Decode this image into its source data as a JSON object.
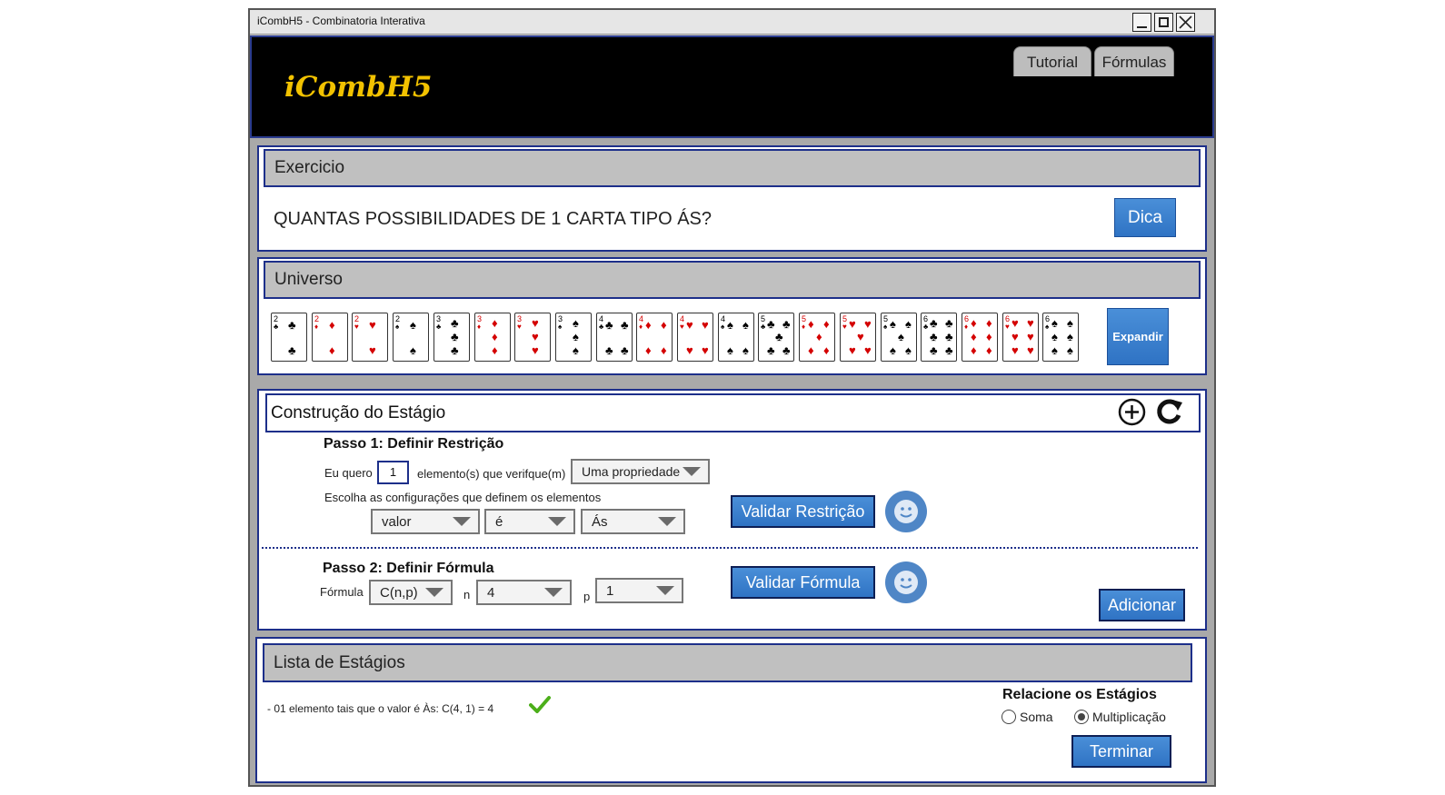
{
  "window": {
    "title": "iCombH5 - Combinatoria Interativa"
  },
  "header": {
    "logo": "iCombH5",
    "tabs": [
      {
        "label": "Tutorial"
      },
      {
        "label": "Fórmulas"
      }
    ]
  },
  "exercise": {
    "title": "Exercicio",
    "question": "QUANTAS POSSIBILIDADES DE 1 CARTA TIPO ÁS?",
    "hint_button": "Dica"
  },
  "universe": {
    "title": "Universo",
    "expand_button": "Expandir",
    "cards": [
      {
        "rank": "2",
        "suit": "♣",
        "color": "#000000"
      },
      {
        "rank": "2",
        "suit": "♦",
        "color": "#d40000"
      },
      {
        "rank": "2",
        "suit": "♥",
        "color": "#d40000"
      },
      {
        "rank": "2",
        "suit": "♠",
        "color": "#000000"
      },
      {
        "rank": "3",
        "suit": "♣",
        "color": "#000000"
      },
      {
        "rank": "3",
        "suit": "♦",
        "color": "#d40000"
      },
      {
        "rank": "3",
        "suit": "♥",
        "color": "#d40000"
      },
      {
        "rank": "3",
        "suit": "♠",
        "color": "#000000"
      },
      {
        "rank": "4",
        "suit": "♣",
        "color": "#000000"
      },
      {
        "rank": "4",
        "suit": "♦",
        "color": "#d40000"
      },
      {
        "rank": "4",
        "suit": "♥",
        "color": "#d40000"
      },
      {
        "rank": "4",
        "suit": "♠",
        "color": "#000000"
      },
      {
        "rank": "5",
        "suit": "♣",
        "color": "#000000"
      },
      {
        "rank": "5",
        "suit": "♦",
        "color": "#d40000"
      },
      {
        "rank": "5",
        "suit": "♥",
        "color": "#d40000"
      },
      {
        "rank": "5",
        "suit": "♠",
        "color": "#000000"
      },
      {
        "rank": "6",
        "suit": "♣",
        "color": "#000000"
      },
      {
        "rank": "6",
        "suit": "♦",
        "color": "#d40000"
      },
      {
        "rank": "6",
        "suit": "♥",
        "color": "#d40000"
      },
      {
        "rank": "6",
        "suit": "♠",
        "color": "#000000"
      }
    ]
  },
  "construction": {
    "title": "Construção do Estágio",
    "add_icon": "plus-circle-icon",
    "reset_icon": "refresh-icon",
    "step1": {
      "title": "Passo 1: Definir Restrição",
      "i_want": "Eu quero",
      "quantity": "1",
      "elements_text": "elemento(s) que verifque(m)",
      "property_select": "Uma propriedade",
      "config_text": "Escolha as configurações que definem os elementos",
      "selects": [
        "valor",
        "é",
        "Ás"
      ],
      "validate_button": "Validar Restrição"
    },
    "step2": {
      "title": "Passo 2: Definir Fórmula",
      "formula_label": "Fórmula",
      "formula_select": "C(n,p)",
      "n_label": "n",
      "n_select": "4",
      "p_label": "p",
      "p_select": "1",
      "validate_button": "Validar Fórmula"
    },
    "add_button": "Adicionar"
  },
  "stages": {
    "title": "Lista de Estágios",
    "items": [
      {
        "text": "- 01 elemento tais que o valor é Às: C(4, 1) = 4"
      }
    ],
    "relate_title": "Relacione os Estágios",
    "options": [
      {
        "label": "Soma",
        "selected": false
      },
      {
        "label": "Multiplicação",
        "selected": true
      }
    ],
    "finish_button": "Terminar"
  },
  "colors": {
    "accent": "#2f73c4",
    "border": "#1d2f8a",
    "logo": "#f2c200",
    "check": "#4caf1a"
  }
}
